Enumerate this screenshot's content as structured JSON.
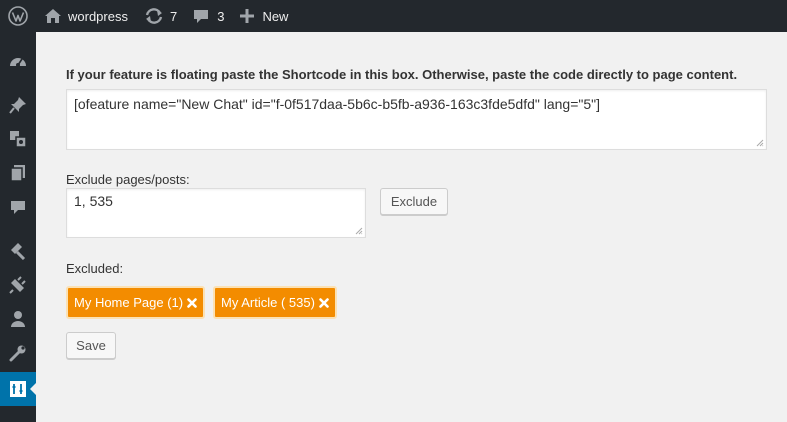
{
  "adminbar": {
    "site_name": "wordpress",
    "updates_count": "7",
    "comments_count": "3",
    "new_label": "New"
  },
  "sidebar": {
    "items": [
      {
        "icon": "dashboard-icon"
      },
      {
        "icon": "pin-icon"
      },
      {
        "icon": "media-icon"
      },
      {
        "icon": "pages-icon"
      },
      {
        "icon": "comments-icon"
      },
      {
        "icon": "appearance-icon"
      },
      {
        "icon": "plugins-icon"
      },
      {
        "icon": "users-icon"
      },
      {
        "icon": "tools-icon"
      },
      {
        "icon": "plugin-settings-icon",
        "current": true
      }
    ]
  },
  "form": {
    "shortcode_label": "If your feature is floating paste the Shortcode in this box. Otherwise, paste the code directly to page content.",
    "shortcode_value": "[ofeature name=\"New Chat\" id=\"f-0f517daa-5b6c-b5fb-a936-163c3fde5dfd\" lang=\"5\"]",
    "exclude_label": "Exclude pages/posts:",
    "exclude_value": "1, 535",
    "exclude_button": "Exclude",
    "excluded_label": "Excluded:",
    "excluded_items": [
      "My Home Page (1)",
      "My Article ( 535)"
    ],
    "save_button": "Save"
  },
  "colors": {
    "adminbar_bg": "#23282d",
    "accent": "#0073aa",
    "tag_bg": "#f38c00",
    "page_bg": "#f1f1f1"
  }
}
